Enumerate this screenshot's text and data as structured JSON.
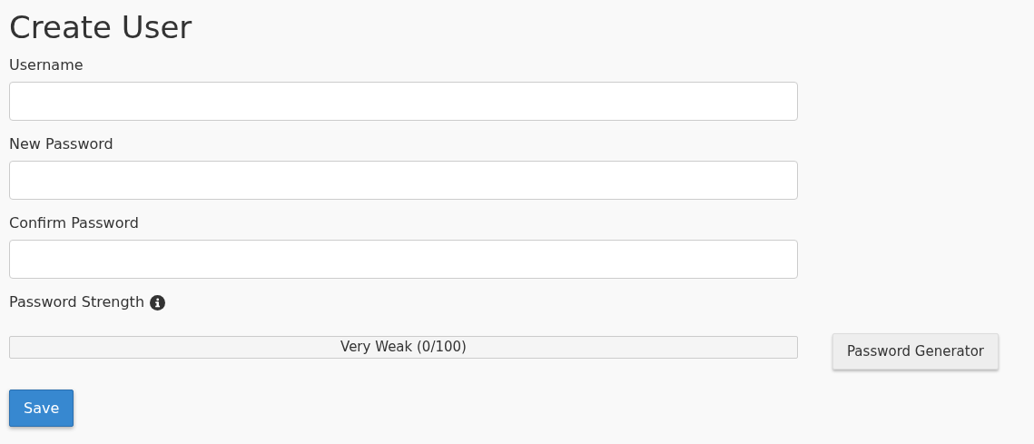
{
  "title": "Create User",
  "fields": [
    {
      "label": "Username"
    },
    {
      "label": "New Password"
    },
    {
      "label": "Confirm Password"
    }
  ],
  "strength": {
    "label": "Password Strength",
    "reading": "Very Weak (0/100)",
    "level": 0
  },
  "generator_button": "Password Generator",
  "save_button": "Save"
}
